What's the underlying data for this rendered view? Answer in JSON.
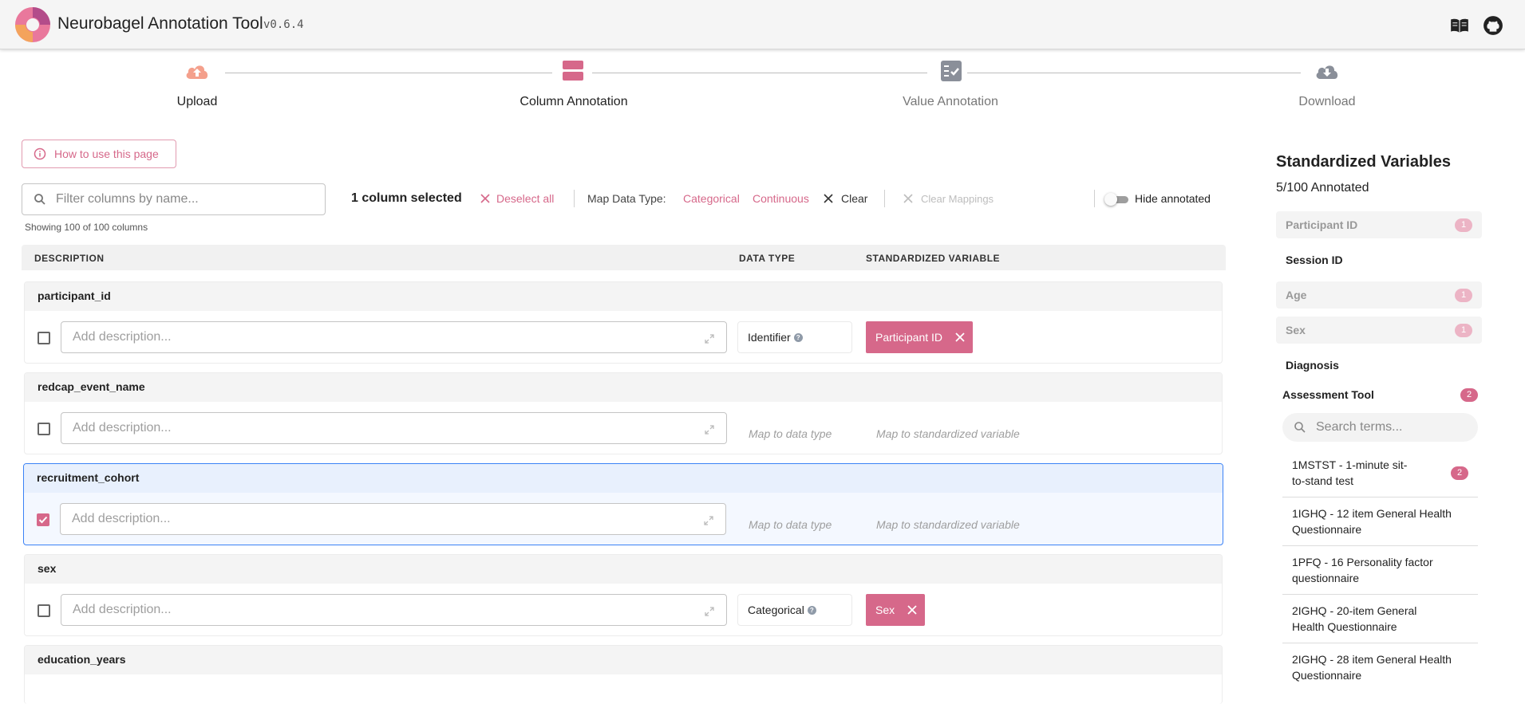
{
  "header": {
    "title": "Neurobagel Annotation Tool",
    "version": "v0.6.4",
    "icons": [
      "docs-book-icon",
      "github-icon"
    ]
  },
  "stepper": {
    "steps": [
      {
        "label": "Upload",
        "icon": "upload-cloud-icon",
        "state": "done"
      },
      {
        "label": "Column Annotation",
        "icon": "columns-icon",
        "state": "active"
      },
      {
        "label": "Value Annotation",
        "icon": "checklist-icon",
        "state": "inactive"
      },
      {
        "label": "Download",
        "icon": "download-cloud-icon",
        "state": "inactive"
      }
    ]
  },
  "help": {
    "label": "How to use this page",
    "icon": "info-icon"
  },
  "filter": {
    "placeholder": "Filter columns by name...",
    "showing": "Showing 100 of 100 columns"
  },
  "toolbar": {
    "selected": "1 column selected",
    "deselect": "Deselect all",
    "map_label": "Map Data Type:",
    "categorical": "Categorical",
    "continuous": "Continuous",
    "clear": "Clear",
    "clear_mappings": "Clear Mappings",
    "hide_annotated": "Hide annotated",
    "hide_annotated_on": false
  },
  "table": {
    "headers": {
      "description": "DESCRIPTION",
      "data_type": "DATA TYPE",
      "std_var": "STANDARDIZED VARIABLE"
    },
    "desc_placeholder": "Add description...",
    "dtype_placeholder": "Map to data type",
    "var_placeholder": "Map to standardized variable",
    "rows": [
      {
        "name": "participant_id",
        "checked": false,
        "data_type": "Identifier",
        "variable": "Participant ID"
      },
      {
        "name": "redcap_event_name",
        "checked": false,
        "data_type": null,
        "variable": null
      },
      {
        "name": "recruitment_cohort",
        "checked": true,
        "data_type": null,
        "variable": null
      },
      {
        "name": "sex",
        "checked": false,
        "data_type": "Categorical",
        "variable": "Sex"
      },
      {
        "name": "education_years",
        "checked": false,
        "data_type": null,
        "variable": null
      }
    ]
  },
  "right_panel": {
    "title": "Standardized Variables",
    "annotated": "5/100 Annotated",
    "items": [
      {
        "label": "Participant ID",
        "count": "1",
        "done": true
      },
      {
        "label": "Session ID",
        "count": null,
        "done": false
      },
      {
        "label": "Age",
        "count": "1",
        "done": true
      },
      {
        "label": "Sex",
        "count": "1",
        "done": true
      },
      {
        "label": "Diagnosis",
        "count": null,
        "done": false
      },
      {
        "label": "Assessment Tool",
        "count": "2",
        "done": false
      }
    ],
    "search_placeholder": "Search terms...",
    "terms": [
      {
        "label": "1MSTST - 1-minute sit-to-stand test",
        "count": "2"
      },
      {
        "label": "1IGHQ - 12 item General Health Questionnaire",
        "count": null
      },
      {
        "label": "1PFQ - 16 Personality factor questionnaire",
        "count": null
      },
      {
        "label": "2IGHQ - 20-item General Health Questionnaire",
        "count": null
      },
      {
        "label": "2IGHQ - 28 item General Health Questionnaire",
        "count": null
      }
    ]
  },
  "colors": {
    "accent": "#d6688a",
    "accent_light": "#ecb4c5",
    "selected_border": "#3b82f6"
  }
}
